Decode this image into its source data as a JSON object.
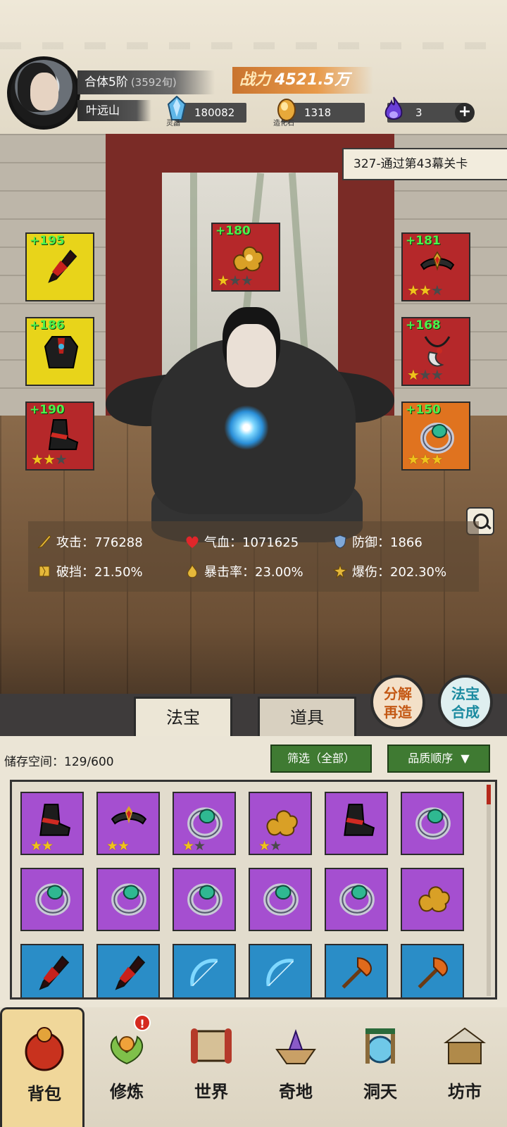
{
  "player": {
    "realm": "合体5阶",
    "realm_sub": "(3592旬)",
    "name": "叶远山",
    "power_label": "战力",
    "power_value": "4521.5万"
  },
  "resources": [
    {
      "caption": "灵晶",
      "value": "180082",
      "icon": "blue-crystal-icon"
    },
    {
      "caption": "造化石",
      "value": "1318",
      "icon": "golden-stone-icon"
    },
    {
      "caption": "",
      "value": "3",
      "icon": "purple-flame-icon"
    }
  ],
  "stage_banner": "327-通过第43幕关卡",
  "equipment": {
    "left": [
      {
        "plus": "+195",
        "stars": 0,
        "quality": "yellow",
        "icon": "dagger-icon"
      },
      {
        "plus": "+186",
        "stars": 0,
        "quality": "yellow",
        "icon": "robe-icon"
      },
      {
        "plus": "+190",
        "stars": 2,
        "quality": "red",
        "icon": "boots-icon"
      }
    ],
    "top": {
      "plus": "+180",
      "stars": 1,
      "quality": "red",
      "icon": "golden-cloud-icon"
    },
    "right": [
      {
        "plus": "+181",
        "stars": 2,
        "quality": "red",
        "icon": "headband-icon"
      },
      {
        "plus": "+168",
        "stars": 1,
        "quality": "red",
        "icon": "necklace-icon"
      },
      {
        "plus": "+150",
        "stars": 3,
        "quality": "orange",
        "icon": "jade-ring-icon"
      }
    ]
  },
  "stats": {
    "attack": "攻击：776288",
    "hp": "气血：1071625",
    "defense": "防御：1866",
    "break": "破挡：21.50%",
    "crit_rate": "暴击率：23.00%",
    "crit_damage": "爆伤：202.30%"
  },
  "tabs": {
    "treasure": "法宝",
    "items": "道具"
  },
  "buttons": {
    "decompose_line1": "分解",
    "decompose_line2": "再造",
    "synth_line1": "法宝",
    "synth_line2": "合成"
  },
  "inventory": {
    "storage": "储存空间：129/600",
    "filter": "筛选（全部）",
    "sort": "品质顺序",
    "rows": [
      [
        {
          "quality": "purple",
          "stars": 2,
          "max": 2,
          "icon": "boots-icon"
        },
        {
          "quality": "purple",
          "stars": 2,
          "max": 2,
          "icon": "headband-icon"
        },
        {
          "quality": "purple",
          "stars": 1,
          "max": 2,
          "icon": "jade-ring-icon"
        },
        {
          "quality": "purple",
          "stars": 1,
          "max": 2,
          "icon": "golden-cloud-icon"
        },
        {
          "quality": "purple",
          "stars": 0,
          "max": 0,
          "icon": "boots-icon"
        },
        {
          "quality": "purple",
          "stars": 0,
          "max": 0,
          "icon": "jade-ring-icon"
        }
      ],
      [
        {
          "quality": "purple",
          "stars": 0,
          "max": 0,
          "icon": "jade-ring-icon"
        },
        {
          "quality": "purple",
          "stars": 0,
          "max": 0,
          "icon": "jade-ring-icon"
        },
        {
          "quality": "purple",
          "stars": 0,
          "max": 0,
          "icon": "jade-ring-icon"
        },
        {
          "quality": "purple",
          "stars": 0,
          "max": 0,
          "icon": "jade-ring-icon"
        },
        {
          "quality": "purple",
          "stars": 0,
          "max": 0,
          "icon": "jade-ring-icon"
        },
        {
          "quality": "purple",
          "stars": 0,
          "max": 0,
          "icon": "golden-cloud-icon"
        }
      ],
      [
        {
          "quality": "blue",
          "stars": 0,
          "max": 0,
          "icon": "dagger-icon"
        },
        {
          "quality": "blue",
          "stars": 0,
          "max": 0,
          "icon": "dagger-icon"
        },
        {
          "quality": "blue",
          "stars": 0,
          "max": 0,
          "icon": "bow-icon"
        },
        {
          "quality": "blue",
          "stars": 0,
          "max": 0,
          "icon": "bow-icon"
        },
        {
          "quality": "blue",
          "stars": 0,
          "max": 0,
          "icon": "axe-icon"
        },
        {
          "quality": "blue",
          "stars": 0,
          "max": 0,
          "icon": "axe-icon"
        }
      ]
    ]
  },
  "nav": [
    {
      "label": "背包",
      "icon": "bag-icon",
      "active": true,
      "badge": ""
    },
    {
      "label": "修炼",
      "icon": "lotus-icon",
      "active": false,
      "badge": "!"
    },
    {
      "label": "世界",
      "icon": "scroll-map-icon",
      "active": false,
      "badge": ""
    },
    {
      "label": "奇地",
      "icon": "floating-island-icon",
      "active": false,
      "badge": ""
    },
    {
      "label": "洞天",
      "icon": "portal-gate-icon",
      "active": false,
      "badge": ""
    },
    {
      "label": "坊市",
      "icon": "market-stall-icon",
      "active": false,
      "badge": ""
    }
  ],
  "colors": {
    "yellow": "#e8d41a",
    "red": "#b5282a",
    "orange": "#e0731f",
    "purple": "#a54fd0",
    "blue": "#2a8dc7",
    "plus_green": "#4cf04c",
    "star_gold": "#f0c21c"
  }
}
